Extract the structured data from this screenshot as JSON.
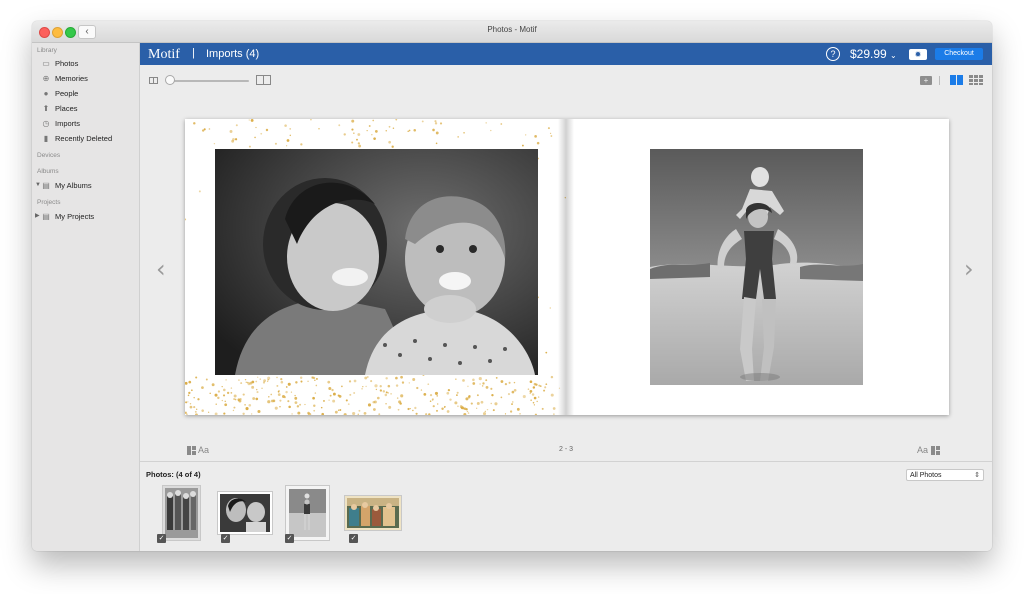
{
  "window": {
    "title": "Photos - Motif"
  },
  "sidebar": {
    "library_header": "Library",
    "library_items": [
      {
        "label": "Photos",
        "icon": "photos-icon"
      },
      {
        "label": "Memories",
        "icon": "memories-icon"
      },
      {
        "label": "People",
        "icon": "people-icon"
      },
      {
        "label": "Places",
        "icon": "places-icon"
      },
      {
        "label": "Imports",
        "icon": "imports-icon"
      },
      {
        "label": "Recently Deleted",
        "icon": "trash-icon"
      }
    ],
    "devices_header": "Devices",
    "albums_header": "Albums",
    "albums_item": "My Albums",
    "projects_header": "Projects",
    "projects_item": "My Projects"
  },
  "motif_bar": {
    "logo": "Motif",
    "separator": "|",
    "section": "Imports (4)",
    "help": "?",
    "price": "$29.99",
    "checkout": "Checkout",
    "color": "#2a5fa8"
  },
  "book": {
    "page_number": "2 - 3",
    "text_tool": "Aa"
  },
  "bottom": {
    "photos_count": "Photos: (4 of 4)",
    "filter": "All Photos"
  },
  "colors": {
    "accent": "#1b7ce8",
    "confetti": "#d9a93e"
  }
}
